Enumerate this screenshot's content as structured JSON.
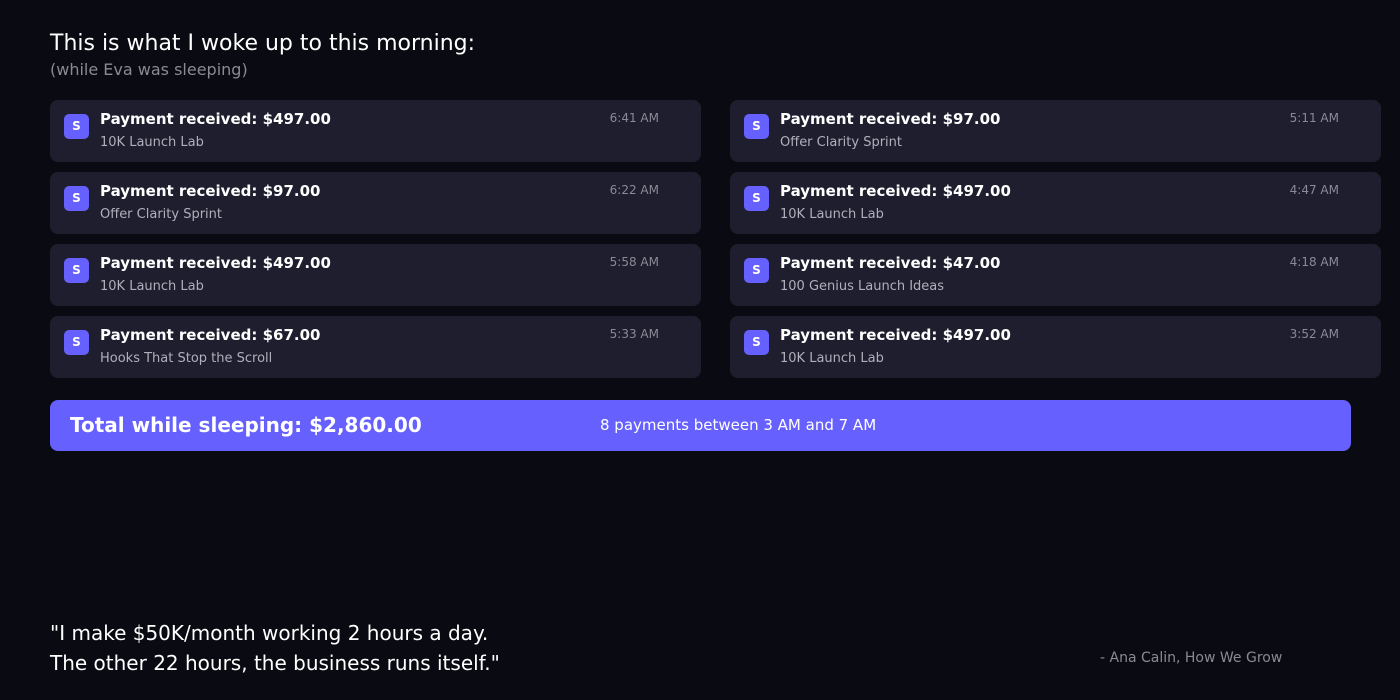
{
  "header": {
    "title": "This is what I woke up to this morning:",
    "subtitle": "(while Eva was sleeping)"
  },
  "colors": {
    "background": "#0a0a12",
    "card": "#1e1e2e",
    "accent": "#6660ff"
  },
  "notifications": [
    {
      "app_icon": "stripe-icon",
      "icon_letter": "S",
      "title": "Payment received: $497.00",
      "product": "10K Launch Lab",
      "time": "6:41 AM"
    },
    {
      "app_icon": "stripe-icon",
      "icon_letter": "S",
      "title": "Payment received: $97.00",
      "product": "Offer Clarity Sprint",
      "time": "5:11 AM"
    },
    {
      "app_icon": "stripe-icon",
      "icon_letter": "S",
      "title": "Payment received: $97.00",
      "product": "Offer Clarity Sprint",
      "time": "6:22 AM"
    },
    {
      "app_icon": "stripe-icon",
      "icon_letter": "S",
      "title": "Payment received: $497.00",
      "product": "10K Launch Lab",
      "time": "4:47 AM"
    },
    {
      "app_icon": "stripe-icon",
      "icon_letter": "S",
      "title": "Payment received: $497.00",
      "product": "10K Launch Lab",
      "time": "5:58 AM"
    },
    {
      "app_icon": "stripe-icon",
      "icon_letter": "S",
      "title": "Payment received: $47.00",
      "product": "100 Genius Launch Ideas",
      "time": "4:18 AM"
    },
    {
      "app_icon": "stripe-icon",
      "icon_letter": "S",
      "title": "Payment received: $67.00",
      "product": "Hooks That Stop the Scroll",
      "time": "5:33 AM"
    },
    {
      "app_icon": "stripe-icon",
      "icon_letter": "S",
      "title": "Payment received: $497.00",
      "product": "10K Launch Lab",
      "time": "3:52 AM"
    }
  ],
  "total": {
    "label": "Total while sleeping: $2,860.00",
    "detail": "8 payments between 3 AM and 7 AM"
  },
  "quote": {
    "line1": "\"I make $50K/month working 2 hours a day.",
    "line2": "The other 22 hours, the business runs itself.\"",
    "attribution": "- Ana Calin, How We Grow"
  }
}
